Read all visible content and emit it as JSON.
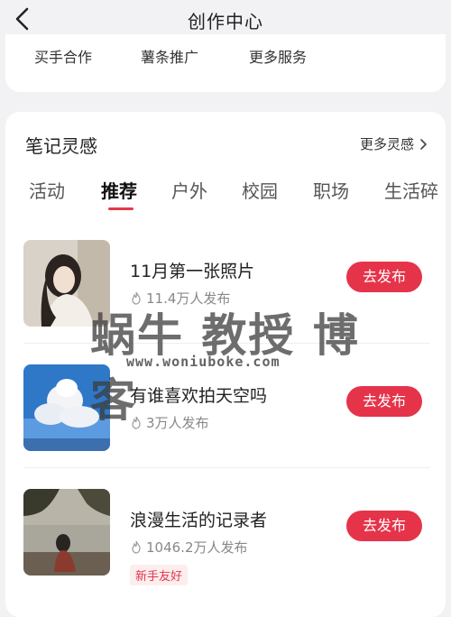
{
  "header": {
    "title": "创作中心",
    "back_icon": "chevron-left-icon"
  },
  "services": {
    "items": [
      "买手合作",
      "薯条推广",
      "更多服务"
    ]
  },
  "inspiration": {
    "title": "笔记灵感",
    "more_label": "更多灵感",
    "tabs": [
      "活动",
      "推荐",
      "户外",
      "校园",
      "职场",
      "生活碎"
    ],
    "active_tab": "推荐",
    "items": [
      {
        "title": "11月第一张照片",
        "count": "11.4万人发布",
        "button": "去发布",
        "badge": ""
      },
      {
        "title": "有谁喜欢拍天空吗",
        "count": "3万人发布",
        "button": "去发布",
        "badge": ""
      },
      {
        "title": "浪漫生活的记录者",
        "count": "1046.2万人发布",
        "button": "去发布",
        "badge": "新手友好"
      }
    ]
  },
  "watermark": {
    "logo_text": "蜗牛 教授 博客",
    "url": "www.woniuboke.com"
  },
  "colors": {
    "accent": "#e5344a",
    "background": "#f2f2f4"
  }
}
